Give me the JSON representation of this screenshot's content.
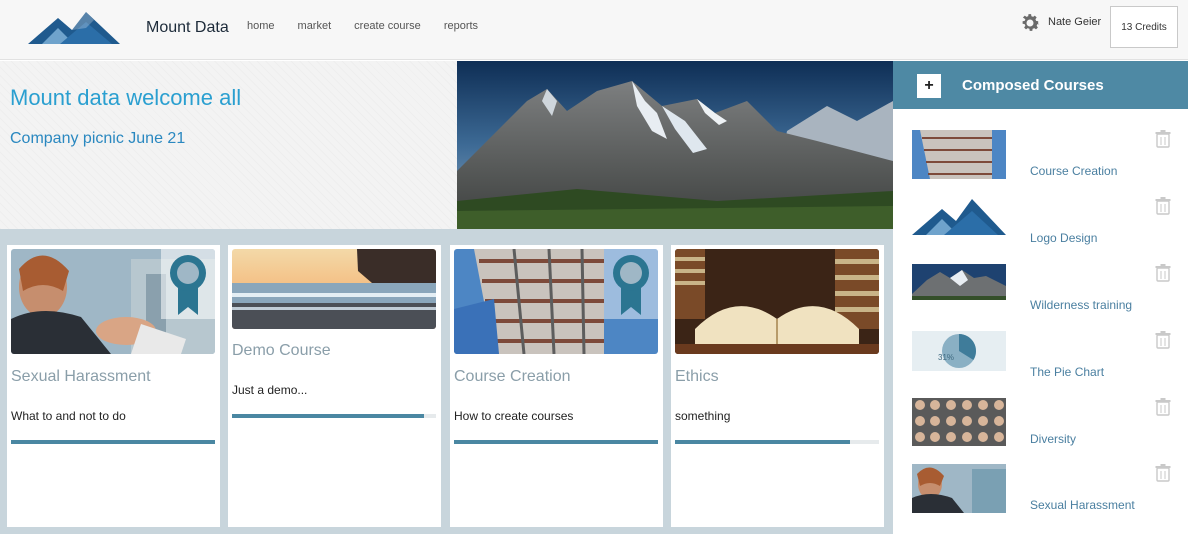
{
  "header": {
    "brand": "Mount Data",
    "nav": [
      "home",
      "market",
      "create course",
      "reports"
    ],
    "user_name": "Nate Geier",
    "credits": "13 Credits"
  },
  "welcome": {
    "title": "Mount data welcome all",
    "subtitle": "Company picnic June 21"
  },
  "courses": [
    {
      "title": "Sexual Harassment",
      "description": "What to and not to do",
      "progress": 1.0,
      "badge": true,
      "image": "woman-shoulder-photo"
    },
    {
      "title": "Demo Course",
      "description": "Just a demo...",
      "progress": 0.94,
      "badge": false,
      "image": "beach-sunset-photo"
    },
    {
      "title": "Course Creation",
      "description": "How to create courses",
      "progress": 1.0,
      "badge": true,
      "image": "building-photo"
    },
    {
      "title": "Ethics",
      "description": "something",
      "progress": 0.86,
      "badge": false,
      "image": "open-book-photo"
    }
  ],
  "sidebar": {
    "title": "Composed Courses",
    "add_label": "+",
    "items": [
      {
        "label": "Course Creation",
        "thumb": "building"
      },
      {
        "label": "Logo Design",
        "thumb": "logo"
      },
      {
        "label": "Wilderness training",
        "thumb": "mountains"
      },
      {
        "label": "The Pie Chart",
        "thumb": "pie",
        "pie_label": "31%"
      },
      {
        "label": "Diversity",
        "thumb": "faces-grid"
      },
      {
        "label": "Sexual Harassment",
        "thumb": "woman"
      }
    ]
  },
  "colors": {
    "accent": "#4e89a4",
    "title_blue": "#2a9fd0",
    "progress": "#4a87a2",
    "card_bg": "#c8d5dc"
  }
}
